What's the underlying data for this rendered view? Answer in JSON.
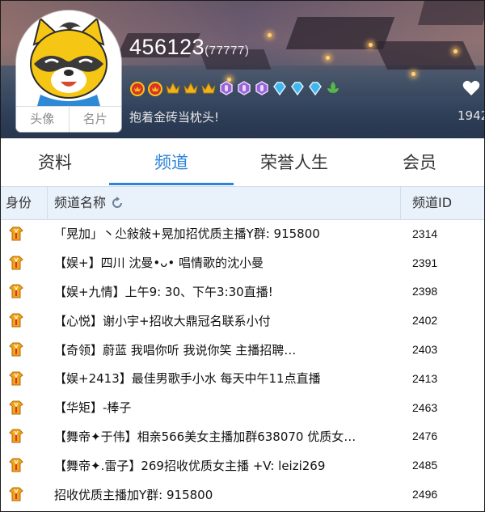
{
  "profile": {
    "username": "456123",
    "user_number": "(77777)",
    "motto": "抱着金砖当枕头!",
    "fans_count": "1942",
    "avatar_tabs": [
      "头像",
      "名片"
    ],
    "badges": [
      {
        "icon": "red-crown-medal-icon",
        "color": "#d9332b"
      },
      {
        "icon": "red-crown-medal-icon",
        "color": "#d9332b"
      },
      {
        "icon": "gold-crown-icon",
        "color": "#f1b51c"
      },
      {
        "icon": "gold-crown-icon",
        "color": "#f1b51c"
      },
      {
        "icon": "gold-crown-icon",
        "color": "#f1b51c"
      },
      {
        "icon": "purple-gem-icon",
        "color": "#9a63d6"
      },
      {
        "icon": "purple-gem-icon",
        "color": "#9a63d6"
      },
      {
        "icon": "purple-gem-icon",
        "color": "#9a63d6"
      },
      {
        "icon": "blue-diamond-icon",
        "color": "#3fb6ec"
      },
      {
        "icon": "blue-diamond-icon",
        "color": "#3fb6ec"
      },
      {
        "icon": "blue-diamond-icon",
        "color": "#3fb6ec"
      },
      {
        "icon": "green-leaf-icon",
        "color": "#55b84a"
      }
    ]
  },
  "tabs": [
    {
      "label": "资料",
      "active": false
    },
    {
      "label": "频道",
      "active": true
    },
    {
      "label": "荣誉人生",
      "active": false
    },
    {
      "label": "会员",
      "active": false
    }
  ],
  "table": {
    "headers": {
      "role": "身份",
      "name": "频道名称",
      "id": "频道ID"
    },
    "rows": [
      {
        "name": "「晃加」丶尐敍敍+晃加招优质主播Y群: 915800",
        "id": "2314"
      },
      {
        "name": "【娱+】四川 沈曼•ᴗ•  唱情歌的沈小曼",
        "id": "2391"
      },
      {
        "name": "【娱+九情】上午9: 30、下午3:30直播!",
        "id": "2398"
      },
      {
        "name": "【心悦】谢小宇+招收大鼎冠名联系小付",
        "id": "2402"
      },
      {
        "name": "【奇领】蔚蓝  我唱你听  我说你笑     主播招聘…",
        "id": "2403"
      },
      {
        "name": "【娱+2413】最佳男歌手小水 每天中午11点直播",
        "id": "2413"
      },
      {
        "name": "【华矩】-棒子",
        "id": "2463"
      },
      {
        "name": "【舞帝✦于伟】相亲566美女主播加群638070 优质女…",
        "id": "2476"
      },
      {
        "name": "【舞帝✦.雷子】269招收优质女主播  +V: leizi269",
        "id": "2485"
      },
      {
        "name": "招收优质主播加Y群: 915800",
        "id": "2496"
      }
    ]
  },
  "colors": {
    "accent": "#2e84d6",
    "header_bg": "#e9f1fb",
    "role_icon": "#f0a41c"
  }
}
